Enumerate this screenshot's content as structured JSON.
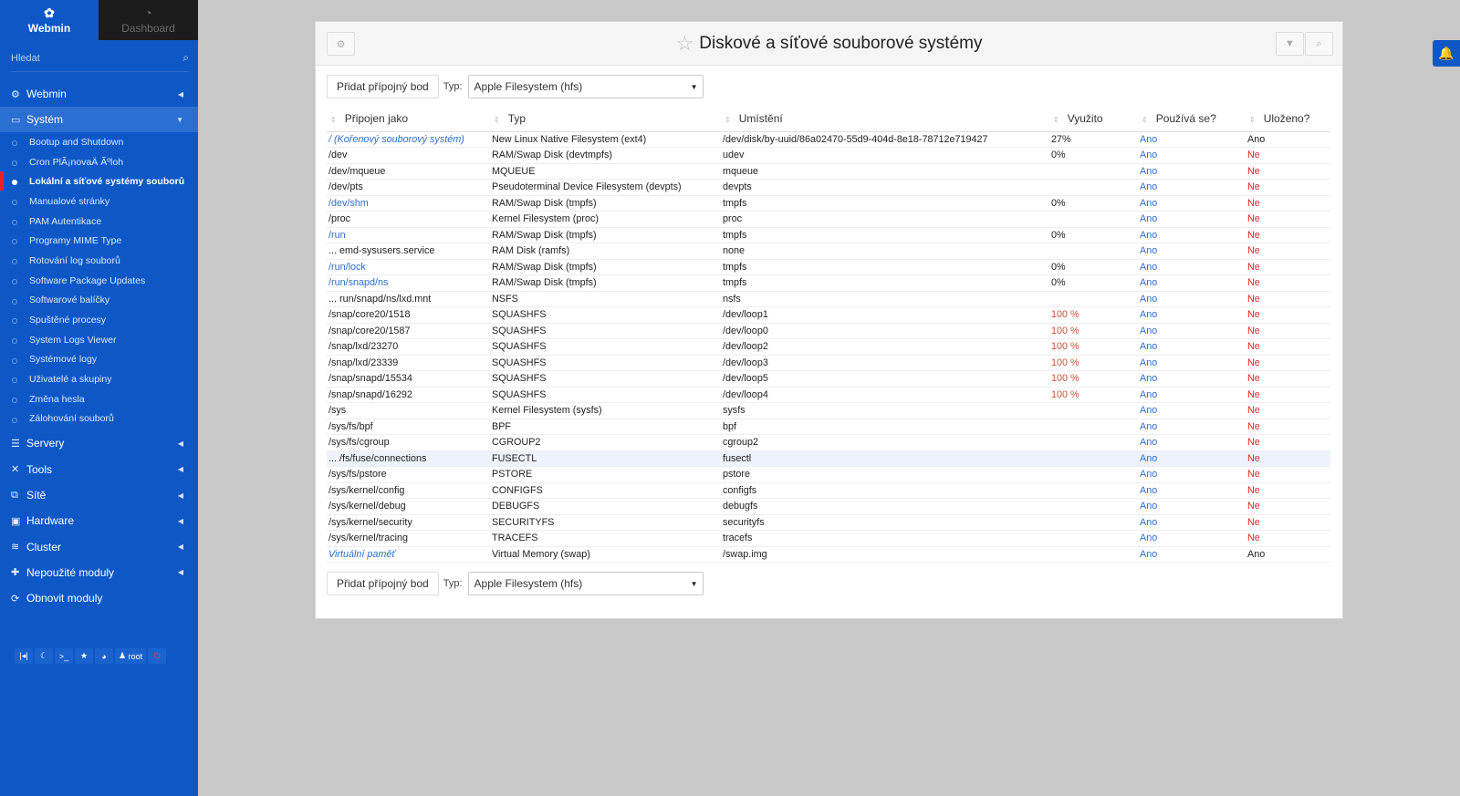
{
  "sidebar": {
    "brand": "Webmin",
    "dashboard": "Dashboard",
    "search_placeholder": "Hledat",
    "categories_top": [
      {
        "label": "Webmin",
        "icon": "gear-icon"
      },
      {
        "label": "Systém",
        "icon": "monitor-icon"
      }
    ],
    "system_items": [
      "Bootup and Shutdown",
      "Cron PlÃ¡novaÄ Ãºloh",
      "Lokální a síťové systémy souborů",
      "Manualové stránky",
      "PAM Autentikace",
      "Programy MIME Type",
      "Rotování log souborů",
      "Software Package Updates",
      "Softwarové balíčky",
      "Spuštěné procesy",
      "System Logs Viewer",
      "Systémové logy",
      "Uživatelé a skupiny",
      "Změna hesla",
      "Zálohování souborů"
    ],
    "categories_bottom": [
      {
        "label": "Servery",
        "icon": "server-icon"
      },
      {
        "label": "Tools",
        "icon": "tools-icon"
      },
      {
        "label": "Sítě",
        "icon": "network-icon"
      },
      {
        "label": "Hardware",
        "icon": "hdd-icon"
      },
      {
        "label": "Cluster",
        "icon": "layers-icon"
      },
      {
        "label": "Nepoužité moduly",
        "icon": "puzzle-icon"
      },
      {
        "label": "Obnovit moduly",
        "icon": "refresh-icon"
      }
    ],
    "user": "root"
  },
  "page": {
    "title": "Diskové a síťové souborové systémy",
    "add_button": "Přidat přípojný bod",
    "type_label": "Typ:",
    "type_value": "Apple Filesystem (hfs)"
  },
  "table": {
    "headers": [
      "Připojen jako",
      "Typ",
      "Umístění",
      "Využito",
      "Používá se?",
      "Uloženo?"
    ],
    "rows": [
      [
        "/ (Kořenový souborový systém)",
        "New Linux Native Filesystem (ext4)",
        "/dev/disk/by-uuid/86a02470-55d9-404d-8e18-78712e719427",
        "27%",
        "Ano",
        "Ano"
      ],
      [
        "/dev",
        "RAM/Swap Disk (devtmpfs)",
        "udev",
        "0%",
        "Ano",
        "Ne"
      ],
      [
        "/dev/mqueue",
        "MQUEUE",
        "mqueue",
        "",
        "Ano",
        "Ne"
      ],
      [
        "/dev/pts",
        "Pseudoterminal Device Filesystem (devpts)",
        "devpts",
        "",
        "Ano",
        "Ne"
      ],
      [
        "/dev/shm",
        "RAM/Swap Disk (tmpfs)",
        "tmpfs",
        "0%",
        "Ano",
        "Ne"
      ],
      [
        "/proc",
        "Kernel Filesystem (proc)",
        "proc",
        "",
        "Ano",
        "Ne"
      ],
      [
        "/run",
        "RAM/Swap Disk (tmpfs)",
        "tmpfs",
        "0%",
        "Ano",
        "Ne"
      ],
      [
        "... emd-sysusers.service",
        "RAM Disk (ramfs)",
        "none",
        "",
        "Ano",
        "Ne"
      ],
      [
        "/run/lock",
        "RAM/Swap Disk (tmpfs)",
        "tmpfs",
        "0%",
        "Ano",
        "Ne"
      ],
      [
        "/run/snapd/ns",
        "RAM/Swap Disk (tmpfs)",
        "tmpfs",
        "0%",
        "Ano",
        "Ne"
      ],
      [
        "... run/snapd/ns/lxd.mnt",
        "NSFS",
        "nsfs",
        "",
        "Ano",
        "Ne"
      ],
      [
        "/snap/core20/1518",
        "SQUASHFS",
        "/dev/loop1",
        "100 %",
        "Ano",
        "Ne"
      ],
      [
        "/snap/core20/1587",
        "SQUASHFS",
        "/dev/loop0",
        "100 %",
        "Ano",
        "Ne"
      ],
      [
        "/snap/lxd/23270",
        "SQUASHFS",
        "/dev/loop2",
        "100 %",
        "Ano",
        "Ne"
      ],
      [
        "/snap/lxd/23339",
        "SQUASHFS",
        "/dev/loop3",
        "100 %",
        "Ano",
        "Ne"
      ],
      [
        "/snap/snapd/15534",
        "SQUASHFS",
        "/dev/loop5",
        "100 %",
        "Ano",
        "Ne"
      ],
      [
        "/snap/snapd/16292",
        "SQUASHFS",
        "/dev/loop4",
        "100 %",
        "Ano",
        "Ne"
      ],
      [
        "/sys",
        "Kernel Filesystem (sysfs)",
        "sysfs",
        "",
        "Ano",
        "Ne"
      ],
      [
        "/sys/fs/bpf",
        "BPF",
        "bpf",
        "",
        "Ano",
        "Ne"
      ],
      [
        "/sys/fs/cgroup",
        "CGROUP2",
        "cgroup2",
        "",
        "Ano",
        "Ne"
      ],
      [
        "... /fs/fuse/connections",
        "FUSECTL",
        "fusectl",
        "",
        "Ano",
        "Ne"
      ],
      [
        "/sys/fs/pstore",
        "PSTORE",
        "pstore",
        "",
        "Ano",
        "Ne"
      ],
      [
        "/sys/kernel/config",
        "CONFIGFS",
        "configfs",
        "",
        "Ano",
        "Ne"
      ],
      [
        "/sys/kernel/debug",
        "DEBUGFS",
        "debugfs",
        "",
        "Ano",
        "Ne"
      ],
      [
        "/sys/kernel/security",
        "SECURITYFS",
        "securityfs",
        "",
        "Ano",
        "Ne"
      ],
      [
        "/sys/kernel/tracing",
        "TRACEFS",
        "tracefs",
        "",
        "Ano",
        "Ne"
      ],
      [
        "Virtuální paměť",
        "Virtual Memory (swap)",
        "/swap.img",
        "",
        "Ano",
        "Ano"
      ]
    ]
  }
}
